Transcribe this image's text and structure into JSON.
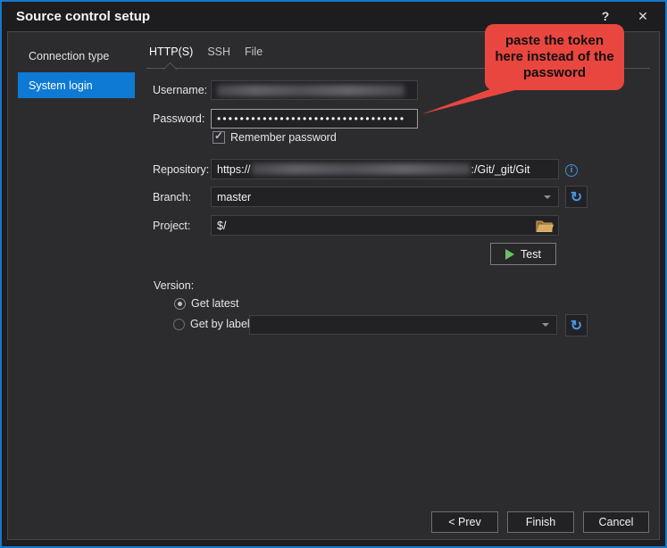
{
  "window": {
    "title": "Source control setup",
    "help_button": "?",
    "close_button": "✕"
  },
  "sidebar": {
    "heading": "Connection type",
    "items": [
      {
        "label": "System login",
        "selected": true
      }
    ]
  },
  "tabs": [
    {
      "label": "HTTP(S)",
      "active": true
    },
    {
      "label": "SSH",
      "active": false
    },
    {
      "label": "File",
      "active": false
    }
  ],
  "form": {
    "username": {
      "label": "Username:",
      "value_redacted": true
    },
    "password": {
      "label": "Password:",
      "masked_value": "•••••••••••••••••••••••••••••••••"
    },
    "remember": {
      "label": "Remember password",
      "checked": true
    },
    "repository": {
      "label": "Repository:",
      "value_prefix": "https://",
      "value_redacted_middle": true,
      "value_suffix": ":/Git/_git/Git"
    },
    "branch": {
      "label": "Branch:",
      "value": "master"
    },
    "project": {
      "label": "Project:",
      "value": "$/"
    },
    "test_button_label": "Test",
    "version": {
      "label": "Version:",
      "options": [
        {
          "label": "Get latest",
          "selected": true
        },
        {
          "label": "Get by label:",
          "selected": false,
          "value": ""
        }
      ]
    }
  },
  "callout": {
    "lines": [
      "paste the token",
      "here instead of the",
      "password"
    ],
    "color": "#e9463f",
    "text_color": "#101010"
  },
  "footer": {
    "prev_label": "< Prev",
    "finish_label": "Finish",
    "cancel_label": "Cancel"
  },
  "icons": {
    "refresh_glyph": "↻",
    "check_glyph": "✓"
  },
  "colors": {
    "window_border": "#1878c8",
    "titlebar_bg": "#1d1d1f",
    "panel_bg": "#2c2c2f",
    "selection_blue": "#0e7ad3",
    "accent_blue_icon": "#4b96e0",
    "folder_tan": "#d9aa60",
    "play_green": "#6cc066"
  }
}
